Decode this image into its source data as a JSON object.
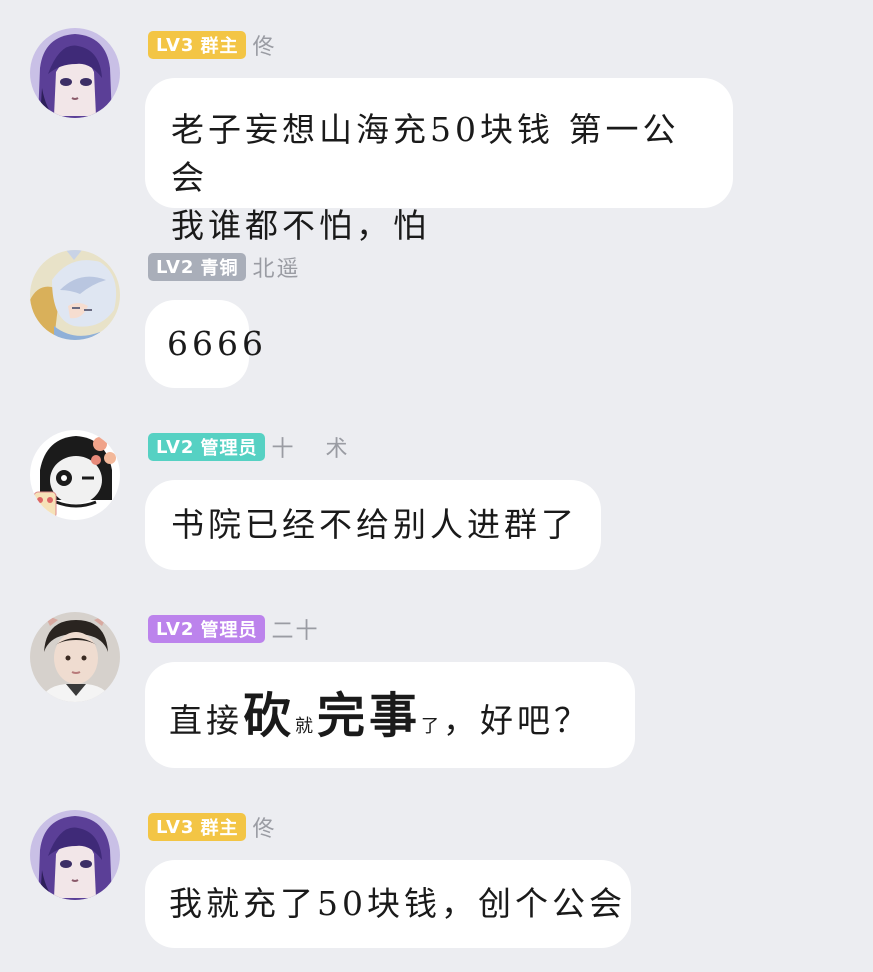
{
  "colors": {
    "background": "#ecedf1",
    "bubble": "#ffffff",
    "badge_owner": "#f3c545",
    "badge_bronze": "#a9aeb9",
    "badge_admin_teal": "#56d1c3",
    "badge_admin_purple": "#bc83ec",
    "nickname": "#9a9ca3"
  },
  "messages": [
    {
      "avatar_icon": "purple-hair-anime-avatar-icon",
      "badge_level": "LV3",
      "badge_title": "群主",
      "badge_color": "#f3c545",
      "nickname": "佟",
      "lines": [
        "老子妄想山海充50块钱 第一公会",
        "我谁都不怕，怕"
      ]
    },
    {
      "avatar_icon": "white-hair-sleeping-anime-avatar-icon",
      "badge_level": "LV2",
      "badge_title": "青铜",
      "badge_color": "#a9aeb9",
      "nickname": "北遥",
      "lines": [
        "6666"
      ]
    },
    {
      "avatar_icon": "sticker-girl-avatar-icon",
      "badge_level": "LV2",
      "badge_title": "管理员",
      "badge_color": "#56d1c3",
      "nickname": "十  术",
      "lines": [
        "书院已经不给别人进群了"
      ]
    },
    {
      "avatar_icon": "photo-boy-avatar-icon",
      "badge_level": "LV2",
      "badge_title": "管理员",
      "badge_color": "#bc83ec",
      "nickname": "二十",
      "segments": [
        {
          "text": "直接",
          "size": "normal"
        },
        {
          "text": "砍",
          "size": "big"
        },
        {
          "text": "就",
          "size": "tiny"
        },
        {
          "text": "完事",
          "size": "big"
        },
        {
          "text": "了",
          "size": "tiny"
        },
        {
          "text": "，好吧？",
          "size": "normal"
        }
      ]
    },
    {
      "avatar_icon": "purple-hair-anime-avatar-icon",
      "badge_level": "LV3",
      "badge_title": "群主",
      "badge_color": "#f3c545",
      "nickname": "佟",
      "lines": [
        "我就充了50块钱，创个公会"
      ]
    }
  ]
}
